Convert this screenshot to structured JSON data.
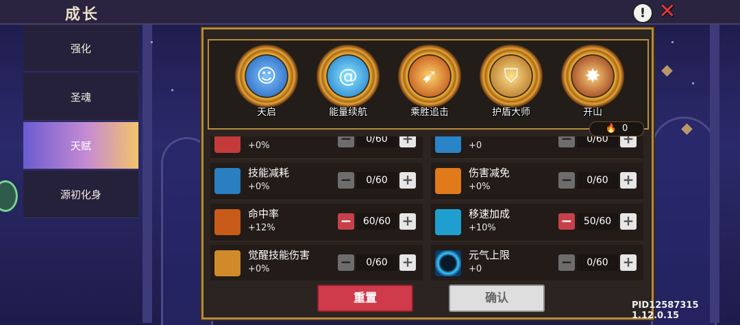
{
  "header": {
    "title": "成长",
    "help_icon": "!",
    "close_icon": "✕"
  },
  "sidebar": {
    "items": [
      {
        "label": "强化",
        "active": false
      },
      {
        "label": "圣魂",
        "active": false
      },
      {
        "label": "天赋",
        "active": true
      },
      {
        "label": "源初化身",
        "active": false
      }
    ]
  },
  "skills": [
    {
      "name": "天启",
      "icon": "figure-icon",
      "color": "#3a86e8"
    },
    {
      "name": "能量续航",
      "icon": "swirl-icon",
      "color": "#2aa6e8"
    },
    {
      "name": "乘胜追击",
      "icon": "strike-icon",
      "color": "#e86a1a"
    },
    {
      "name": "护盾大师",
      "icon": "shield-icon",
      "color": "#e8a11a"
    },
    {
      "name": "开山",
      "icon": "blast-icon",
      "color": "#e84a1a"
    }
  ],
  "talent_points": {
    "value": "0"
  },
  "stats": [
    {
      "name": "",
      "value": "+0%",
      "level": "0/60",
      "minus_active": false,
      "icon_color": "#c43a3a"
    },
    {
      "name": "",
      "value": "+0",
      "level": "0/60",
      "minus_active": false,
      "icon_color": "#2a84c8"
    },
    {
      "name": "技能减耗",
      "value": "+0%",
      "level": "0/60",
      "minus_active": false,
      "icon_color": "#2a7fc0"
    },
    {
      "name": "伤害减免",
      "value": "+0%",
      "level": "0/60",
      "minus_active": false,
      "icon_color": "#e07a1a"
    },
    {
      "name": "命中率",
      "value": "+12%",
      "level": "60/60",
      "minus_active": true,
      "icon_color": "#c85a1a"
    },
    {
      "name": "移速加成",
      "value": "+10%",
      "level": "50/60",
      "minus_active": true,
      "icon_color": "#1f9fd0"
    },
    {
      "name": "觉醒技能伤害",
      "value": "+0%",
      "level": "0/60",
      "minus_active": false,
      "icon_color": "#d08a2a"
    },
    {
      "name": "元气上限",
      "value": "+0",
      "level": "0/60",
      "minus_active": false,
      "icon_color": "#1a7ab8"
    }
  ],
  "buttons": {
    "minus": "−",
    "plus": "+",
    "reset": "重置",
    "confirm": "确认"
  },
  "version": "PID12587315 1.12.0.15"
}
